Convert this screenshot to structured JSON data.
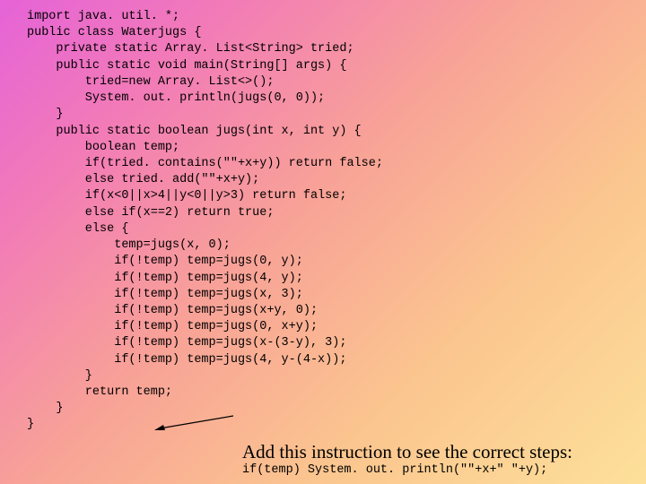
{
  "code": {
    "line1": "import java. util. *;",
    "line2": "public class Waterjugs {",
    "line3": "    private static Array. List<String> tried;",
    "line4": "    public static void main(String[] args) {",
    "line5": "        tried=new Array. List<>();",
    "line6": "        System. out. println(jugs(0, 0));",
    "line7": "    }",
    "line8": "    public static boolean jugs(int x, int y) {",
    "line9": "        boolean temp;",
    "line10": "        if(tried. contains(\"\"+x+y)) return false;",
    "line11": "        else tried. add(\"\"+x+y);",
    "line12": "        if(x<0||x>4||y<0||y>3) return false;",
    "line13": "        else if(x==2) return true;",
    "line14": "        else {",
    "line15": "            temp=jugs(x, 0);",
    "line16": "            if(!temp) temp=jugs(0, y);",
    "line17": "            if(!temp) temp=jugs(4, y);",
    "line18": "            if(!temp) temp=jugs(x, 3);",
    "line19": "            if(!temp) temp=jugs(x+y, 0);",
    "line20": "            if(!temp) temp=jugs(0, x+y);",
    "line21": "            if(!temp) temp=jugs(x-(3-y), 3);",
    "line22": "            if(!temp) temp=jugs(4, y-(4-x));",
    "line23": "        }",
    "line24": "        return temp;",
    "line25": "    }",
    "line26": "}"
  },
  "annotation": {
    "text": "Add this instruction to see the correct steps:",
    "code": "if(temp) System. out. println(\"\"+x+\" \"+y);"
  }
}
